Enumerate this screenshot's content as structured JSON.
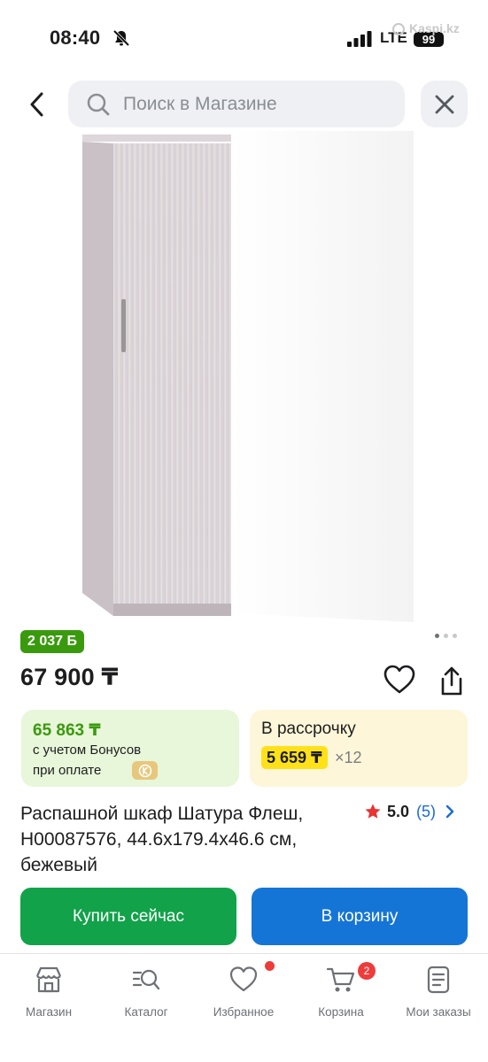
{
  "status_bar": {
    "time": "08:40",
    "network": "LTE",
    "battery": "99",
    "watermark": "Kaspi.kz"
  },
  "search": {
    "placeholder": "Поиск в Магазине"
  },
  "product": {
    "bonus_badge": "2 037 Б",
    "price": "67 900 ₸",
    "bonus_card": {
      "amount": "65 863 ₸",
      "line1": "с учетом Бонусов",
      "line2": "при оплате"
    },
    "credit_card": {
      "title": "В рассрочку",
      "monthly": "5 659 ₸",
      "multiplier": "×12"
    },
    "title": "Распашной шкаф Шатура Флеш, Н00087576, 44.6x179.4x46.6 см, бежевый",
    "rating": {
      "score": "5.0",
      "count": "(5)"
    },
    "image_pages": 3,
    "image_current": 1
  },
  "actions": {
    "buy_now": "Купить сейчас",
    "add_to_cart": "В корзину"
  },
  "nav": {
    "items": [
      {
        "label": "Магазин",
        "icon": "shop-icon"
      },
      {
        "label": "Каталог",
        "icon": "catalog-icon"
      },
      {
        "label": "Избранное",
        "icon": "heart-icon"
      },
      {
        "label": "Корзина",
        "icon": "cart-icon"
      },
      {
        "label": "Мои заказы",
        "icon": "orders-icon"
      }
    ],
    "cart_count": "2"
  },
  "colors": {
    "accent_green": "#12a24a",
    "accent_blue": "#1575d6",
    "bonus_green": "#3a9a0e",
    "credit_yellow": "#ffe11a",
    "badge_red": "#ee3b3b"
  }
}
